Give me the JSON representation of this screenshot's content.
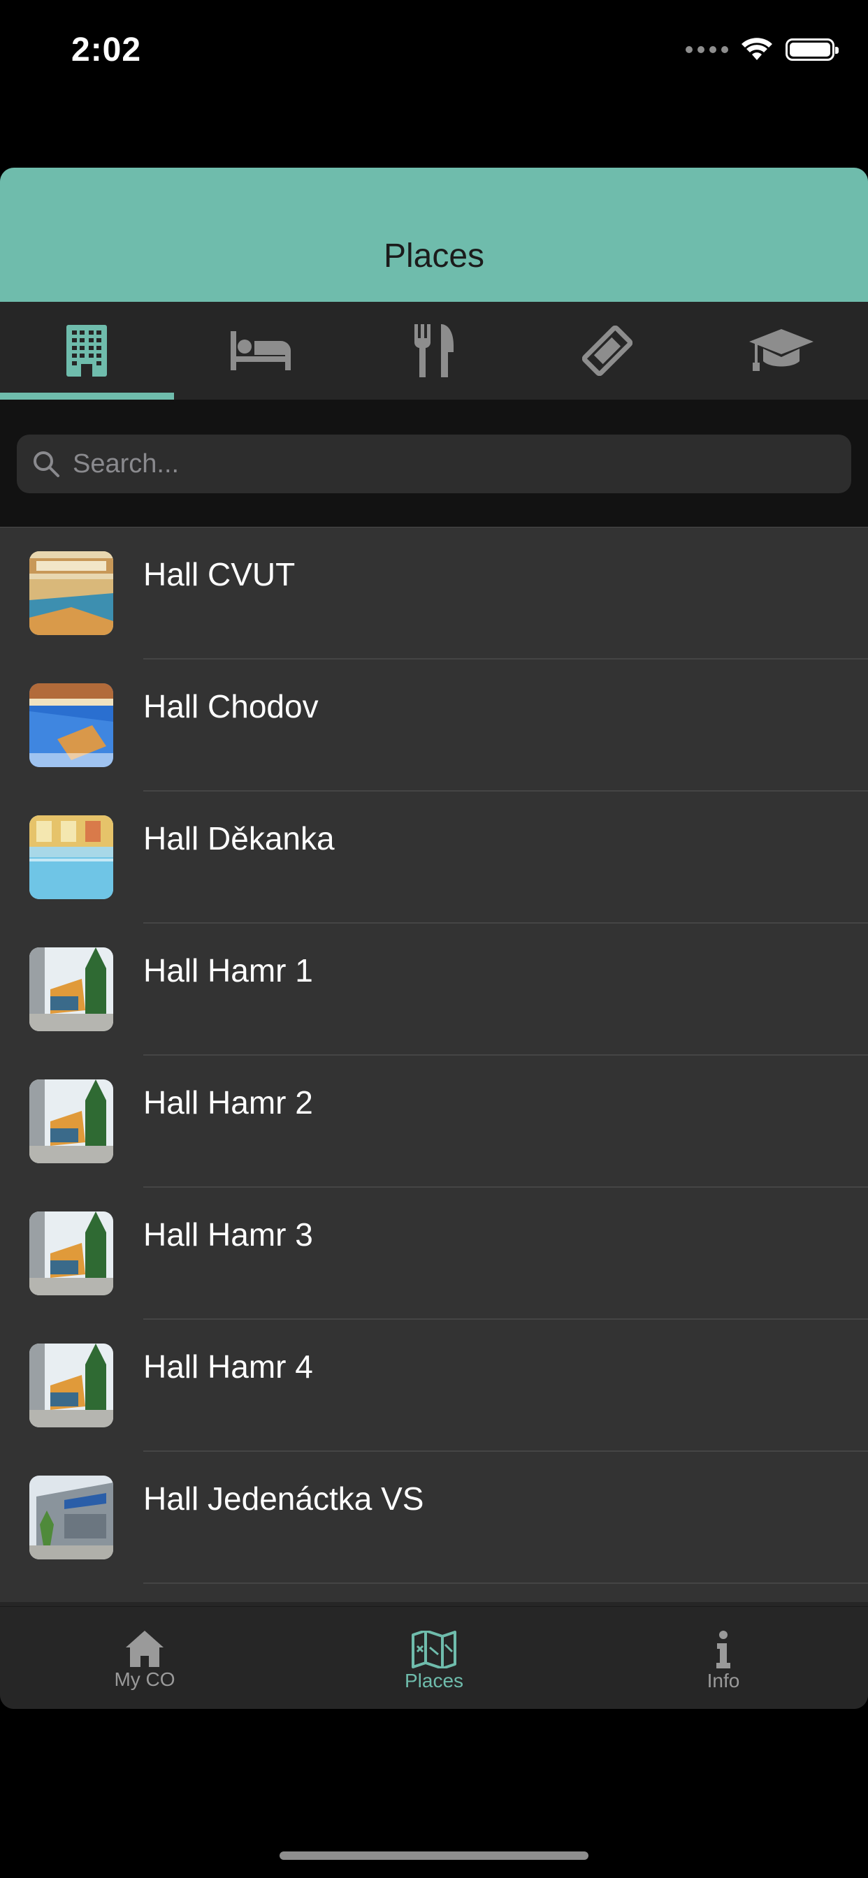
{
  "status_bar": {
    "time": "2:02"
  },
  "header": {
    "title": "Places"
  },
  "category_tabs": [
    {
      "icon": "building-icon",
      "active": true
    },
    {
      "icon": "bed-icon",
      "active": false
    },
    {
      "icon": "fork-knife-icon",
      "active": false
    },
    {
      "icon": "ticket-icon",
      "active": false
    },
    {
      "icon": "graduation-cap-icon",
      "active": false
    }
  ],
  "search": {
    "placeholder": "Search..."
  },
  "places": [
    {
      "name": "Hall CVUT"
    },
    {
      "name": "Hall Chodov"
    },
    {
      "name": "Hall Děkanka"
    },
    {
      "name": "Hall Hamr 1"
    },
    {
      "name": "Hall Hamr 2"
    },
    {
      "name": "Hall Hamr 3"
    },
    {
      "name": "Hall Hamr 4"
    },
    {
      "name": "Hall Jedenáctka VS"
    }
  ],
  "tab_bar": {
    "items": [
      {
        "label": "My CO",
        "icon": "home-icon",
        "active": false
      },
      {
        "label": "Places",
        "icon": "map-icon",
        "active": true
      },
      {
        "label": "Info",
        "icon": "info-icon",
        "active": false
      }
    ]
  },
  "colors": {
    "accent": "#6fbcac",
    "background": "#000000",
    "list_bg": "#333333"
  }
}
